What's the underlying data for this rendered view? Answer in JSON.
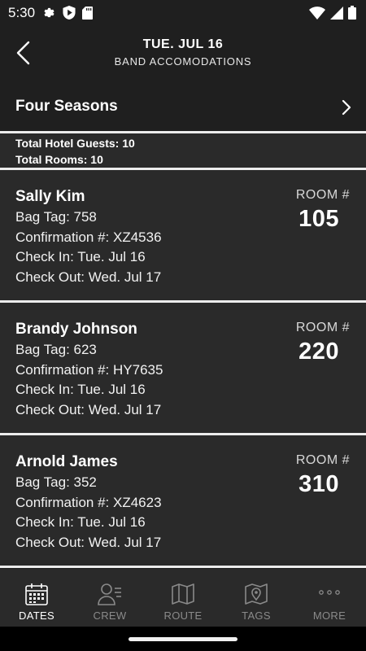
{
  "status_bar": {
    "time": "5:30",
    "left_icons": [
      "gear-icon",
      "shield-play-icon",
      "sd-card-icon"
    ],
    "right_icons": [
      "wifi-icon",
      "signal-icon",
      "battery-icon"
    ]
  },
  "header": {
    "date": "TUE. JUL 16",
    "subtitle": "BAND ACCOMODATIONS",
    "back_icon": "chevron-left-icon"
  },
  "hotel": {
    "name": "Four Seasons",
    "chevron_icon": "chevron-right-icon"
  },
  "totals": {
    "guests": "Total Hotel Guests: 10",
    "rooms": "Total Rooms: 10"
  },
  "guests": [
    {
      "name": "Sally Kim",
      "bag_tag": "Bag Tag: 758",
      "confirmation": "Confirmation #: XZ4536",
      "check_in": "Check In: Tue. Jul 16",
      "check_out": "Check Out: Wed. Jul 17",
      "room_label": "ROOM #",
      "room_number": "105"
    },
    {
      "name": "Brandy Johnson",
      "bag_tag": "Bag Tag: 623",
      "confirmation": "Confirmation #: HY7635",
      "check_in": "Check In: Tue. Jul 16",
      "check_out": "Check Out: Wed. Jul 17",
      "room_label": "ROOM #",
      "room_number": "220"
    },
    {
      "name": "Arnold James",
      "bag_tag": "Bag Tag: 352",
      "confirmation": "Confirmation #: XZ4623",
      "check_in": "Check In: Tue. Jul 16",
      "check_out": "Check Out: Wed. Jul 17",
      "room_label": "ROOM #",
      "room_number": "310"
    }
  ],
  "bottom_nav": {
    "active_color": "#ffffff",
    "inactive_color": "#8a8a8a",
    "items": [
      {
        "label": "DATES",
        "icon": "calendar-icon",
        "active": true
      },
      {
        "label": "CREW",
        "icon": "crew-icon",
        "active": false
      },
      {
        "label": "ROUTE",
        "icon": "map-icon",
        "active": false
      },
      {
        "label": "TAGS",
        "icon": "map-pin-icon",
        "active": false
      },
      {
        "label": "MORE",
        "icon": "more-dots-icon",
        "active": false
      }
    ]
  }
}
